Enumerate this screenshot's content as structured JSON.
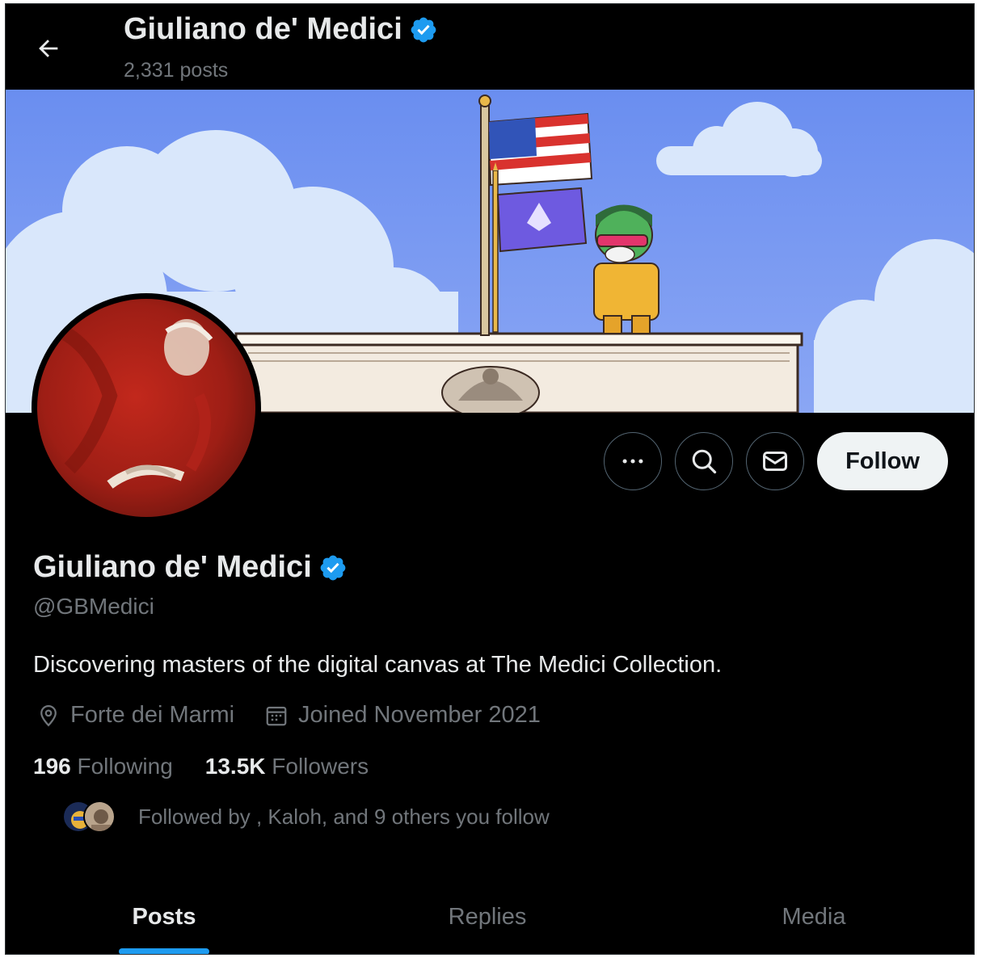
{
  "header": {
    "title": "Giuliano de' Medici",
    "posts_count": "2,331 posts"
  },
  "profile": {
    "name": "Giuliano de' Medici",
    "handle": "@GBMedici",
    "bio": "Discovering masters of the digital canvas at The Medici Collection.",
    "location": "Forte dei Marmi",
    "joined": "Joined November 2021",
    "following_count": "196",
    "following_label": "Following",
    "followers_count": "13.5K",
    "followers_label": "Followers",
    "followed_by": "Followed by  , Kaloh, and 9 others you follow"
  },
  "actions": {
    "follow_label": "Follow",
    "more_icon": "more-horizontal-icon",
    "search_icon": "search-icon",
    "message_icon": "envelope-icon"
  },
  "tabs": [
    {
      "label": "Posts",
      "active": true
    },
    {
      "label": "Replies",
      "active": false
    },
    {
      "label": "Media",
      "active": false
    }
  ],
  "colors": {
    "accent": "#1d9bf0",
    "background": "#000000",
    "text_primary": "#e7e9ea",
    "text_secondary": "#71767b"
  }
}
